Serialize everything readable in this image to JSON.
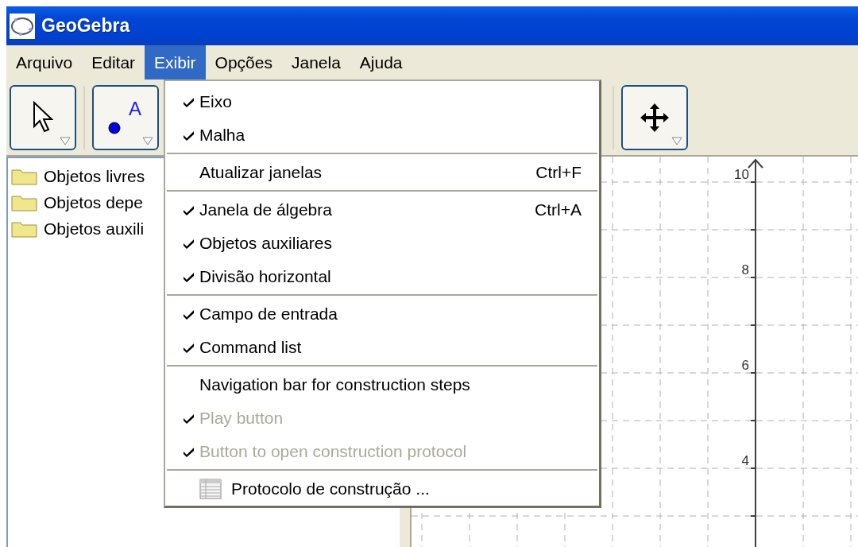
{
  "window": {
    "title": "GeoGebra"
  },
  "menu_bar": {
    "menus": [
      {
        "label": "Arquivo",
        "selected": false
      },
      {
        "label": "Editar",
        "selected": false
      },
      {
        "label": "Exibir",
        "selected": true
      },
      {
        "label": "Opções",
        "selected": false
      },
      {
        "label": "Janela",
        "selected": false
      },
      {
        "label": "Ajuda",
        "selected": false
      }
    ]
  },
  "toolbar": {
    "tools": [
      {
        "kind": "pointer"
      },
      {
        "kind": "point",
        "label": "A"
      },
      {
        "kind": "move"
      }
    ]
  },
  "algebra_view": {
    "folders": [
      {
        "label": "Objetos livres"
      },
      {
        "label": "Objetos depe"
      },
      {
        "label": "Objetos auxili"
      }
    ]
  },
  "graphics_view": {
    "y_labels": [
      "10",
      "8",
      "6",
      "4"
    ]
  },
  "view_menu": {
    "groups": [
      {
        "items": [
          {
            "label": "Eixo",
            "checked": true,
            "disabled": false
          },
          {
            "label": "Malha",
            "checked": true,
            "disabled": false
          }
        ]
      },
      {
        "items": [
          {
            "label": "Atualizar janelas",
            "checked": false,
            "disabled": false,
            "shortcut": "Ctrl+F"
          }
        ]
      },
      {
        "items": [
          {
            "label": "Janela de álgebra",
            "checked": true,
            "disabled": false,
            "shortcut": "Ctrl+A"
          },
          {
            "label": "Objetos auxiliares",
            "checked": true,
            "disabled": false
          },
          {
            "label": "Divisão horizontal",
            "checked": true,
            "disabled": false
          }
        ]
      },
      {
        "items": [
          {
            "label": "Campo de entrada",
            "checked": true,
            "disabled": false
          },
          {
            "label": "Command list",
            "checked": true,
            "disabled": false
          }
        ]
      },
      {
        "items": [
          {
            "label": "Navigation bar for construction steps",
            "checked": false,
            "disabled": false
          },
          {
            "label": "Play button",
            "checked": true,
            "disabled": true
          },
          {
            "label": "Button to open construction protocol",
            "checked": true,
            "disabled": true
          }
        ]
      },
      {
        "items": [
          {
            "label": "Protocolo de construção ...",
            "checked": false,
            "disabled": false,
            "kind": "table"
          }
        ]
      }
    ]
  }
}
